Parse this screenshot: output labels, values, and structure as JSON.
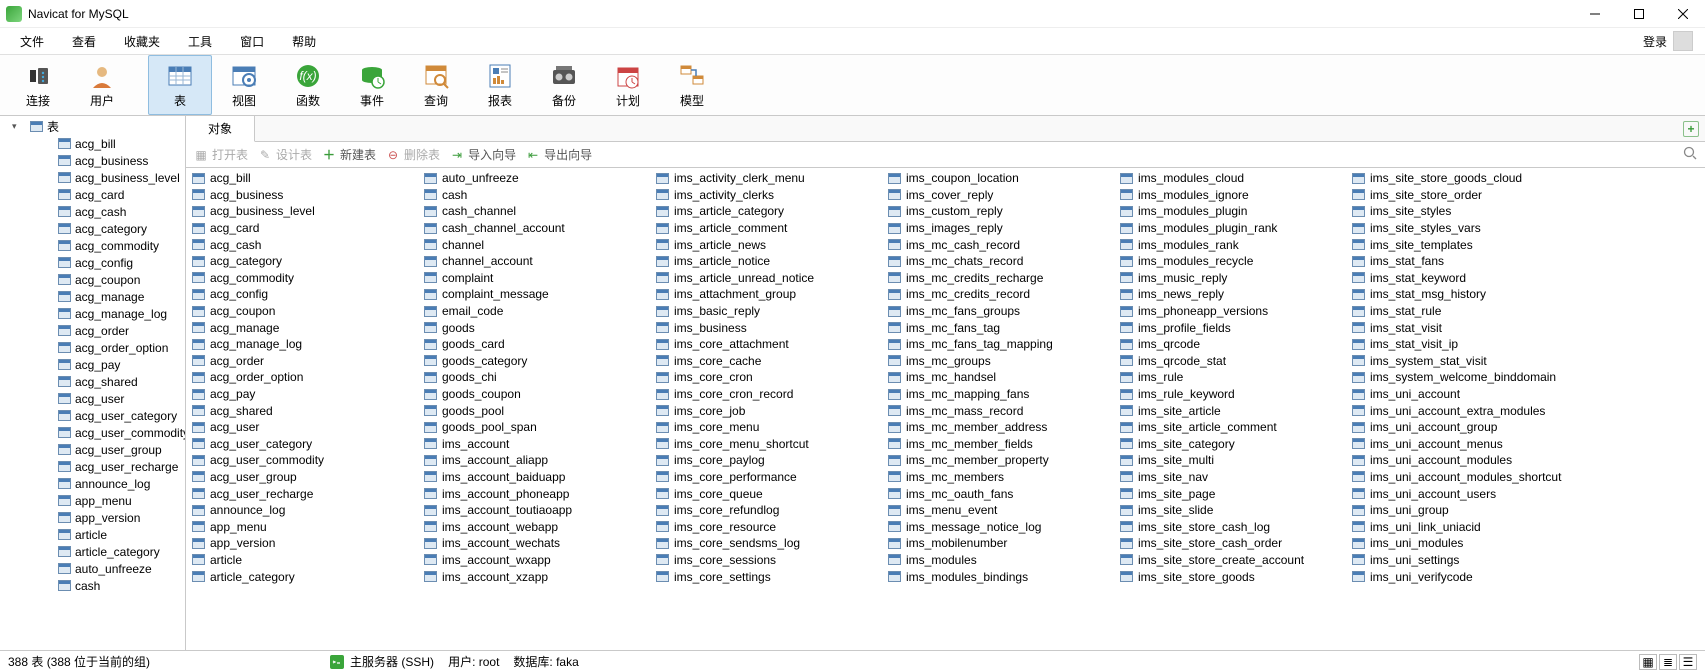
{
  "window": {
    "title": "Navicat for MySQL"
  },
  "menu": {
    "items": [
      "文件",
      "查看",
      "收藏夹",
      "工具",
      "窗口",
      "帮助"
    ],
    "login": "登录"
  },
  "toolbar": {
    "items": [
      {
        "label": "连接",
        "id": "connect"
      },
      {
        "label": "用户",
        "id": "user"
      },
      {
        "label": "表",
        "id": "table",
        "active": true
      },
      {
        "label": "视图",
        "id": "view"
      },
      {
        "label": "函数",
        "id": "function"
      },
      {
        "label": "事件",
        "id": "event"
      },
      {
        "label": "查询",
        "id": "query"
      },
      {
        "label": "报表",
        "id": "report"
      },
      {
        "label": "备份",
        "id": "backup"
      },
      {
        "label": "计划",
        "id": "schedule"
      },
      {
        "label": "模型",
        "id": "model"
      }
    ]
  },
  "sidebar": {
    "root": "表",
    "tables": [
      "acg_bill",
      "acg_business",
      "acg_business_level",
      "acg_card",
      "acg_cash",
      "acg_category",
      "acg_commodity",
      "acg_config",
      "acg_coupon",
      "acg_manage",
      "acg_manage_log",
      "acg_order",
      "acg_order_option",
      "acg_pay",
      "acg_shared",
      "acg_user",
      "acg_user_category",
      "acg_user_commodity",
      "acg_user_group",
      "acg_user_recharge",
      "announce_log",
      "app_menu",
      "app_version",
      "article",
      "article_category",
      "auto_unfreeze",
      "cash"
    ]
  },
  "object_tab": "对象",
  "object_toolbar": {
    "open_table": "打开表",
    "design_table": "设计表",
    "new_table": "新建表",
    "delete_table": "删除表",
    "import_wizard": "导入向导",
    "export_wizard": "导出向导"
  },
  "columns": [
    [
      "acg_bill",
      "acg_business",
      "acg_business_level",
      "acg_card",
      "acg_cash",
      "acg_category",
      "acg_commodity",
      "acg_config",
      "acg_coupon",
      "acg_manage",
      "acg_manage_log",
      "acg_order",
      "acg_order_option",
      "acg_pay",
      "acg_shared",
      "acg_user",
      "acg_user_category",
      "acg_user_commodity",
      "acg_user_group",
      "acg_user_recharge",
      "announce_log",
      "app_menu",
      "app_version",
      "article",
      "article_category"
    ],
    [
      "auto_unfreeze",
      "cash",
      "cash_channel",
      "cash_channel_account",
      "channel",
      "channel_account",
      "complaint",
      "complaint_message",
      "email_code",
      "goods",
      "goods_card",
      "goods_category",
      "goods_chi",
      "goods_coupon",
      "goods_pool",
      "goods_pool_span",
      "ims_account",
      "ims_account_aliapp",
      "ims_account_baiduapp",
      "ims_account_phoneapp",
      "ims_account_toutiaoapp",
      "ims_account_webapp",
      "ims_account_wechats",
      "ims_account_wxapp",
      "ims_account_xzapp"
    ],
    [
      "ims_activity_clerk_menu",
      "ims_activity_clerks",
      "ims_article_category",
      "ims_article_comment",
      "ims_article_news",
      "ims_article_notice",
      "ims_article_unread_notice",
      "ims_attachment_group",
      "ims_basic_reply",
      "ims_business",
      "ims_core_attachment",
      "ims_core_cache",
      "ims_core_cron",
      "ims_core_cron_record",
      "ims_core_job",
      "ims_core_menu",
      "ims_core_menu_shortcut",
      "ims_core_paylog",
      "ims_core_performance",
      "ims_core_queue",
      "ims_core_refundlog",
      "ims_core_resource",
      "ims_core_sendsms_log",
      "ims_core_sessions",
      "ims_core_settings"
    ],
    [
      "ims_coupon_location",
      "ims_cover_reply",
      "ims_custom_reply",
      "ims_images_reply",
      "ims_mc_cash_record",
      "ims_mc_chats_record",
      "ims_mc_credits_recharge",
      "ims_mc_credits_record",
      "ims_mc_fans_groups",
      "ims_mc_fans_tag",
      "ims_mc_fans_tag_mapping",
      "ims_mc_groups",
      "ims_mc_handsel",
      "ims_mc_mapping_fans",
      "ims_mc_mass_record",
      "ims_mc_member_address",
      "ims_mc_member_fields",
      "ims_mc_member_property",
      "ims_mc_members",
      "ims_mc_oauth_fans",
      "ims_menu_event",
      "ims_message_notice_log",
      "ims_mobilenumber",
      "ims_modules",
      "ims_modules_bindings"
    ],
    [
      "ims_modules_cloud",
      "ims_modules_ignore",
      "ims_modules_plugin",
      "ims_modules_plugin_rank",
      "ims_modules_rank",
      "ims_modules_recycle",
      "ims_music_reply",
      "ims_news_reply",
      "ims_phoneapp_versions",
      "ims_profile_fields",
      "ims_qrcode",
      "ims_qrcode_stat",
      "ims_rule",
      "ims_rule_keyword",
      "ims_site_article",
      "ims_site_article_comment",
      "ims_site_category",
      "ims_site_multi",
      "ims_site_nav",
      "ims_site_page",
      "ims_site_slide",
      "ims_site_store_cash_log",
      "ims_site_store_cash_order",
      "ims_site_store_create_account",
      "ims_site_store_goods"
    ],
    [
      "ims_site_store_goods_cloud",
      "ims_site_store_order",
      "ims_site_styles",
      "ims_site_styles_vars",
      "ims_site_templates",
      "ims_stat_fans",
      "ims_stat_keyword",
      "ims_stat_msg_history",
      "ims_stat_rule",
      "ims_stat_visit",
      "ims_stat_visit_ip",
      "ims_system_stat_visit",
      "ims_system_welcome_binddomain",
      "ims_uni_account",
      "ims_uni_account_extra_modules",
      "ims_uni_account_group",
      "ims_uni_account_menus",
      "ims_uni_account_modules",
      "ims_uni_account_modules_shortcut",
      "ims_uni_account_users",
      "ims_uni_group",
      "ims_uni_link_uniacid",
      "ims_uni_modules",
      "ims_uni_settings",
      "ims_uni_verifycode"
    ]
  ],
  "status": {
    "count": "388 表 (388 位于当前的组)",
    "server": "主服务器 (SSH)",
    "user_label": "用户: ",
    "user": "root",
    "db_label": "数据库: ",
    "db": "faka"
  }
}
